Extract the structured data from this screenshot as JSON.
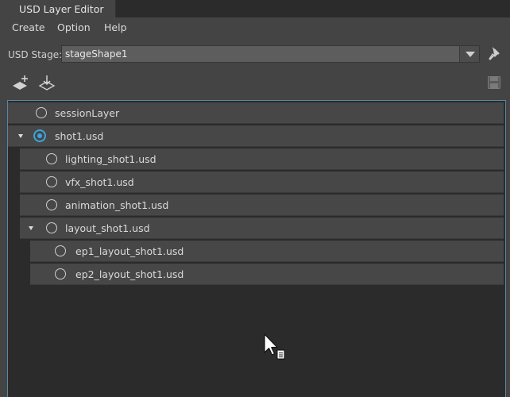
{
  "window": {
    "tab_title": "USD Layer Editor"
  },
  "menu": {
    "items": [
      "Create",
      "Option",
      "Help"
    ]
  },
  "stage": {
    "label": "USD Stage:",
    "value": "stageShape1"
  },
  "toolbar": {
    "icons": [
      "add-layer-icon",
      "load-layer-icon",
      "save-icon",
      "pin-icon"
    ]
  },
  "layers": [
    {
      "name": "sessionLayer",
      "depth": 0,
      "expanded": null,
      "target": false
    },
    {
      "name": "shot1.usd",
      "depth": 0,
      "expanded": true,
      "target": true
    },
    {
      "name": "lighting_shot1.usd",
      "depth": 1,
      "expanded": null,
      "target": false
    },
    {
      "name": "vfx_shot1.usd",
      "depth": 1,
      "expanded": null,
      "target": false
    },
    {
      "name": "animation_shot1.usd",
      "depth": 1,
      "expanded": null,
      "target": false
    },
    {
      "name": "layout_shot1.usd",
      "depth": 1,
      "expanded": true,
      "target": false
    },
    {
      "name": "ep1_layout_shot1.usd",
      "depth": 2,
      "expanded": null,
      "target": false
    },
    {
      "name": "ep2_layout_shot1.usd",
      "depth": 2,
      "expanded": null,
      "target": false
    }
  ],
  "colors": {
    "panel_bg": "#444444",
    "tree_bg": "#2b2b2b",
    "row_bg": "#474747",
    "accent_blue": "#3ba5dd",
    "focus_border": "#5588a8"
  }
}
